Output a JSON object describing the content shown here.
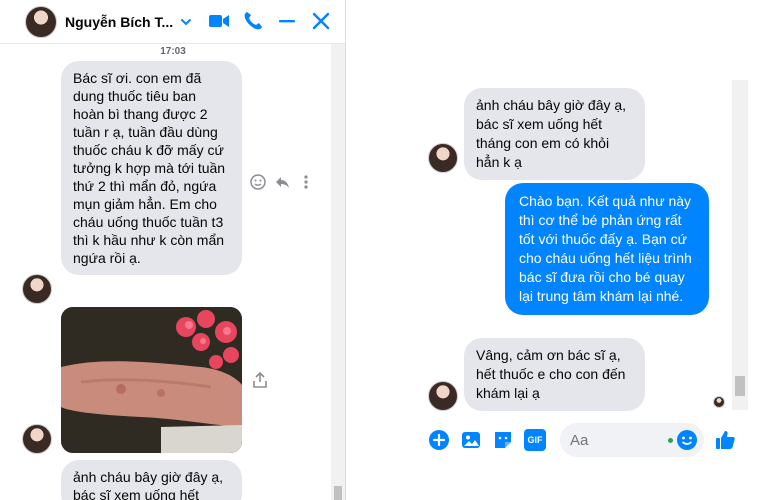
{
  "left_chat": {
    "contact_name": "Nguyễn Bích T...",
    "timestamp": "17:03",
    "messages": {
      "m1": "Bác sĩ ơi. con em đã dung thuốc tiêu ban hoàn bì thang được 2 tuần r ạ, tuần đầu dùng thuốc cháu k đỡ mấy cứ tưởng k hợp mà tới tuần thứ 2 thì mẩn đỏ, ngứa mụn giảm hẳn. Em cho cháu uống thuốc tuần t3 thì k hầu như k còn mẩn ngứa rồi ạ.",
      "m2": "ảnh cháu bây giờ đây ạ, bác sĩ xem uống hết"
    }
  },
  "right_chat": {
    "messages": {
      "in1": "ảnh cháu bây giờ đây ạ, bác sĩ xem uống hết tháng con em có khỏi hẳn k ạ",
      "out1": "Chào bạn. Kết quả như này thì cơ thể bé phản ứng rất tốt với thuốc đấy ạ. Bạn cứ cho cháu uống hết liệu trình bác sĩ đưa rồi cho bé quay lại trung tâm khám lại nhé.",
      "in2": "Vâng, cảm ơn bác sĩ ạ, hết thuốc e cho con đến khám lại ạ"
    },
    "composer_placeholder": "Aa",
    "gif_label": "GIF"
  },
  "colors": {
    "accent": "#0084ff",
    "bubble_in": "#e4e6eb",
    "online": "#31a24c"
  },
  "icons": [
    "video-call-icon",
    "phone-icon",
    "minimize-icon",
    "close-icon",
    "emoji-icon",
    "reply-icon",
    "more-icon",
    "share-icon",
    "plus-icon",
    "photo-icon",
    "sticker-icon",
    "gif-icon",
    "like-icon",
    "chevron-down-icon"
  ]
}
